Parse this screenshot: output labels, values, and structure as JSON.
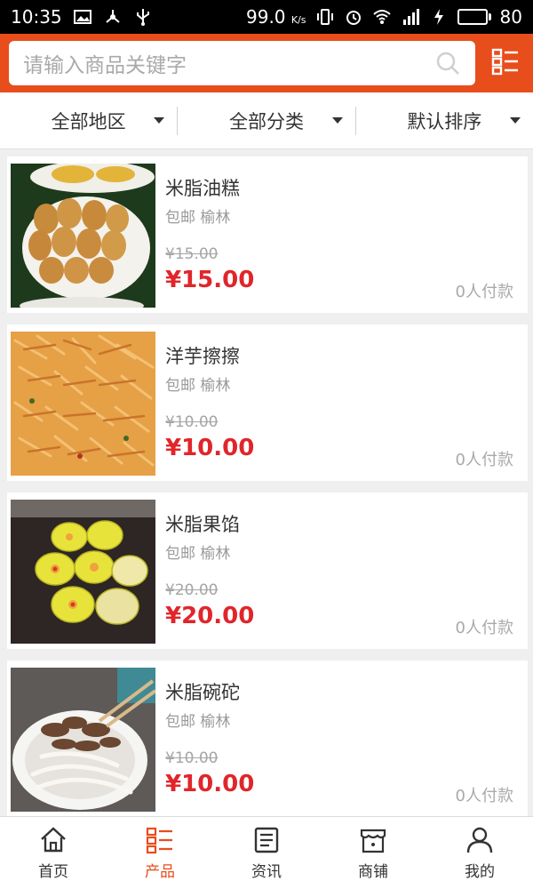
{
  "status_bar": {
    "time": "10:35",
    "speed": "99.0",
    "speed_unit": "K/s",
    "battery": "80",
    "battery_level": 0.8,
    "battery_color": "#37d34a"
  },
  "header": {
    "search_placeholder": "请输入商品关键字",
    "accent_color": "#e84d1c"
  },
  "filters": [
    {
      "label": "全部地区"
    },
    {
      "label": "全部分类"
    },
    {
      "label": "默认排序"
    }
  ],
  "products": [
    {
      "name": "米脂油糕",
      "shipping": "包邮",
      "location": "榆林",
      "old_price": "¥15.00",
      "price": "¥15.00",
      "sales": "0人付款"
    },
    {
      "name": "洋芋擦擦",
      "shipping": "包邮",
      "location": "榆林",
      "old_price": "¥10.00",
      "price": "¥10.00",
      "sales": "0人付款"
    },
    {
      "name": "米脂果馅",
      "shipping": "包邮",
      "location": "榆林",
      "old_price": "¥20.00",
      "price": "¥20.00",
      "sales": "0人付款"
    },
    {
      "name": "米脂碗砣",
      "shipping": "包邮",
      "location": "榆林",
      "old_price": "¥10.00",
      "price": "¥10.00",
      "sales": "0人付款"
    }
  ],
  "nav": [
    {
      "label": "首页",
      "icon": "home-icon",
      "active": false
    },
    {
      "label": "产品",
      "icon": "product-list-icon",
      "active": true
    },
    {
      "label": "资讯",
      "icon": "news-icon",
      "active": false
    },
    {
      "label": "商铺",
      "icon": "store-icon",
      "active": false
    },
    {
      "label": "我的",
      "icon": "user-icon",
      "active": false
    }
  ]
}
